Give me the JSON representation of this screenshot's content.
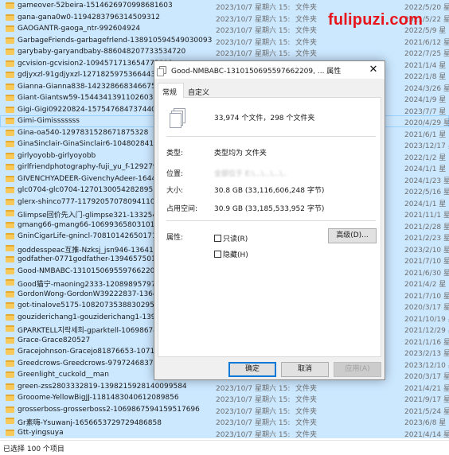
{
  "file_list": {
    "rows": [
      {
        "name": "gameover-52beira-1514626970998681603",
        "date": "2023/10/7 星期六 15:...",
        "type": "文件夹",
        "size": "2022/5/20 星"
      },
      {
        "name": "gana-gana0w0-1194283796314509312",
        "date": "2023/10/7 星期六 15:...",
        "type": "文件夹",
        "size": "2021/5/22 星"
      },
      {
        "name": "GAOGANTR-gaoga_ntr-992604924",
        "date": "2023/10/7 星期六 15:...",
        "type": "文件夹",
        "size": "2022/5/9 星"
      },
      {
        "name": "GarbageFriends-garbagefrlend-1389105945490300935",
        "date": "2023/10/7 星期六 15:...",
        "type": "文件夹",
        "size": "2021/6/12 星"
      },
      {
        "name": "garybaby-garyandbaby-886048207733534720",
        "date": "2023/10/7 星期六 15:...",
        "type": "文件夹",
        "size": "2022/7/25 星"
      },
      {
        "name": "gcvision-gcvision2-1094571713654775808",
        "date": "",
        "type": "",
        "size": "2021/1/4 星"
      },
      {
        "name": "gdjyxzl-91gdjyxzl-1271825975366443008",
        "date": "",
        "type": "",
        "size": "2022/1/8 星"
      },
      {
        "name": "Gianna-Gianna838-1423286683466756104",
        "date": "",
        "type": "",
        "size": "2024/3/26 星"
      },
      {
        "name": "Giant-Giantsw59-1544341391102603266",
        "date": "",
        "type": "",
        "size": "2024/1/9 星"
      },
      {
        "name": "Gigi-Gigi09220824-1575476847374405635",
        "date": "",
        "type": "",
        "size": "2023/7/7 星"
      },
      {
        "name": "Gimi-Gimisssssss",
        "date": "",
        "type": "",
        "size": "2020/4/29 星"
      },
      {
        "name": "Gina-oa540-1297831528671875328",
        "date": "",
        "type": "",
        "size": "2021/6/1 星"
      },
      {
        "name": "GinaSinclair-GinaSinclair6-1048028410230",
        "date": "",
        "type": "",
        "size": "2023/12/17 星"
      },
      {
        "name": "girlyoyobb-girlyoyobb",
        "date": "",
        "type": "",
        "size": "2022/1/2 星"
      },
      {
        "name": "girlfriendphotography-fuji_yu_f-129279089",
        "date": "",
        "type": "",
        "size": "2024/1/1 星"
      },
      {
        "name": "GIVENCHYADEER-GivenchyAdeer-1644128",
        "date": "",
        "type": "",
        "size": "2024/1/23 星"
      },
      {
        "name": "glc0704-glc0704-1270130054282895361",
        "date": "",
        "type": "",
        "size": "2022/5/16 星"
      },
      {
        "name": "glerx-shinco777-1179205707809411072",
        "date": "",
        "type": "",
        "size": "2024/1/1 星"
      },
      {
        "name": "Glimpse回价先入门-glimpse321-133254650",
        "date": "",
        "type": "",
        "size": "2021/11/1 星"
      },
      {
        "name": "gmang66-gmang66-1069936580310126592",
        "date": "",
        "type": "",
        "size": "2021/2/28 星"
      },
      {
        "name": "GninCigarLife-gnincl-708101426501713922",
        "date": "",
        "type": "",
        "size": "2021/2/23 星"
      },
      {
        "name": "goddesspeac互推-Nzksj_jsn946-136415828",
        "date": "",
        "type": "",
        "size": "2023/2/10 星"
      },
      {
        "name": "godfather-0771godfather-1394657501048",
        "date": "",
        "type": "",
        "size": "2021/7/10 星"
      },
      {
        "name": "Good-NMBABC-1310150695597662209",
        "date": "",
        "type": "",
        "size": "2021/6/30 星"
      },
      {
        "name": "Good猫宁-maoning2333-120898957972377",
        "date": "",
        "type": "",
        "size": "2021/4/2 星"
      },
      {
        "name": "GordonWong-GordonW39222837-136414",
        "date": "",
        "type": "",
        "size": "2021/7/10 星"
      },
      {
        "name": "got-tinalove5175-1082073538830295040",
        "date": "",
        "type": "",
        "size": "2020/3/17 星"
      },
      {
        "name": "gouziderichang1-gouziderichang1-139885",
        "date": "",
        "type": "",
        "size": "2021/10/19 星"
      },
      {
        "name": "GPARKTELL지락세희-gparktell-1069867435",
        "date": "",
        "type": "",
        "size": "2021/12/29 星"
      },
      {
        "name": "Grace-Grace820527",
        "date": "",
        "type": "",
        "size": "2021/1/16 星"
      },
      {
        "name": "Gracejohnson-Gracejo81876653-10715854",
        "date": "",
        "type": "",
        "size": "2023/2/13 星"
      },
      {
        "name": "Greedcrows-Greedcrows-9797246837413",
        "date": "",
        "type": "",
        "size": "2023/12/10 星"
      },
      {
        "name": "Greenlight_cuckold__man",
        "date": "2023/10/7 星期六 15:...",
        "type": "文件夹",
        "size": "2020/3/17 星"
      },
      {
        "name": "green-zss2803332819-1398215928140099584",
        "date": "2023/10/7 星期六 15:...",
        "type": "文件夹",
        "size": "2021/4/21 星"
      },
      {
        "name": "Grooome-YellowBigJJ-1181483040612089856",
        "date": "2023/10/7 星期六 15:...",
        "type": "文件夹",
        "size": "2021/9/17 星"
      },
      {
        "name": "grosserboss-grosserboss2-1069867594159517696",
        "date": "2023/10/7 星期六 15:...",
        "type": "文件夹",
        "size": "2021/5/24 星"
      },
      {
        "name": "Gr素嗨-Ysuwanj-1656653729729486858",
        "date": "2023/10/7 星期六 15:...",
        "type": "文件夹",
        "size": "2023/6/8 星"
      },
      {
        "name": "Gtt-yingsuya",
        "date": "2023/10/7 星期六 15:...",
        "type": "文件夹",
        "size": "2021/4/14 星"
      }
    ],
    "status_text": "已选择 100 个项目"
  },
  "watermark": "fulipuzi.com",
  "dialog": {
    "title": "Good-NMBABC-1310150695597662209, ... 属性",
    "close_glyph": "✕",
    "tabs": [
      "常规",
      "自定义"
    ],
    "summary": "33,974 个文件，298 个文件夹",
    "type_label": "类型:",
    "type_value": "类型均为 文件夹",
    "location_label": "位置:",
    "location_value": "全部位于 E:\\...\\...\\...\\..",
    "size_label": "大小:",
    "size_value": "30.8 GB (33,116,606,248 字节)",
    "disk_size_label": "占用空间:",
    "disk_size_value": "30.9 GB (33,185,533,952 字节)",
    "attributes_label": "属性:",
    "readonly_label": "只读(R)",
    "hidden_label": "隐藏(H)",
    "advanced_label": "高级(D)...",
    "ok_label": "确定",
    "cancel_label": "取消",
    "apply_label": "应用(A)"
  }
}
